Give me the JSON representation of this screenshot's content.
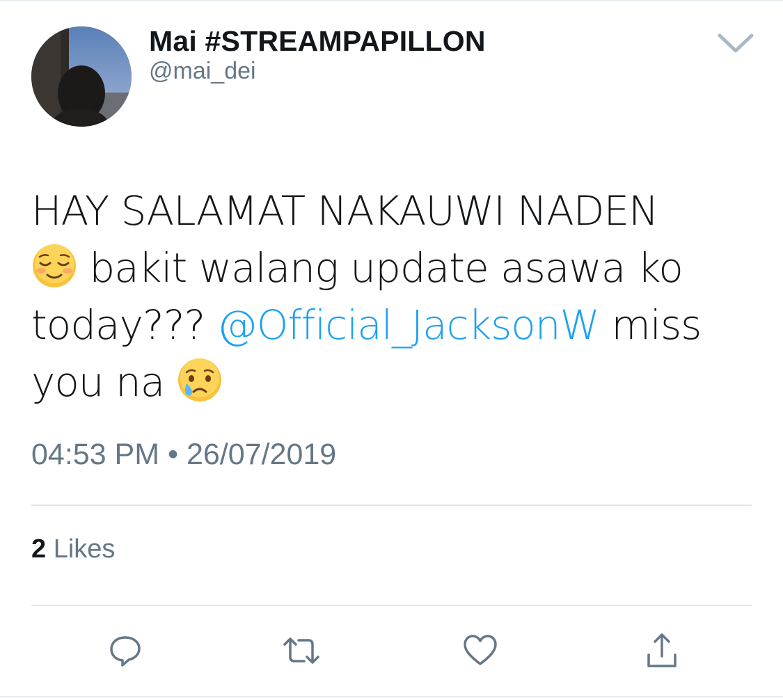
{
  "tweet": {
    "author": {
      "display_name": "Mai #STREAMPAPILLON",
      "handle": "@mai_dei",
      "avatar_icon": "profile-photo"
    },
    "menu_icon": "chevron-down-icon",
    "text": {
      "line1": "HAY SALAMAT NAKAUWI NADEN",
      "emoji_relieved": "relieved-face-emoji",
      "part2": " bakit walang update asawa ko today??? ",
      "mention": "@Official_JacksonW",
      "part3": " miss you na ",
      "emoji_crying": "crying-face-emoji"
    },
    "timestamp": "04:53 PM • 26/07/2019",
    "likes": {
      "count": "2",
      "label": " Likes"
    },
    "actions": [
      {
        "name": "reply",
        "icon": "comment-icon"
      },
      {
        "name": "retweet",
        "icon": "retweet-icon"
      },
      {
        "name": "like",
        "icon": "heart-icon"
      },
      {
        "name": "share",
        "icon": "share-icon"
      }
    ]
  },
  "colors": {
    "text": "#14171a",
    "secondary": "#657786",
    "mention": "#1da1f2",
    "divider": "#e1e8ed"
  }
}
